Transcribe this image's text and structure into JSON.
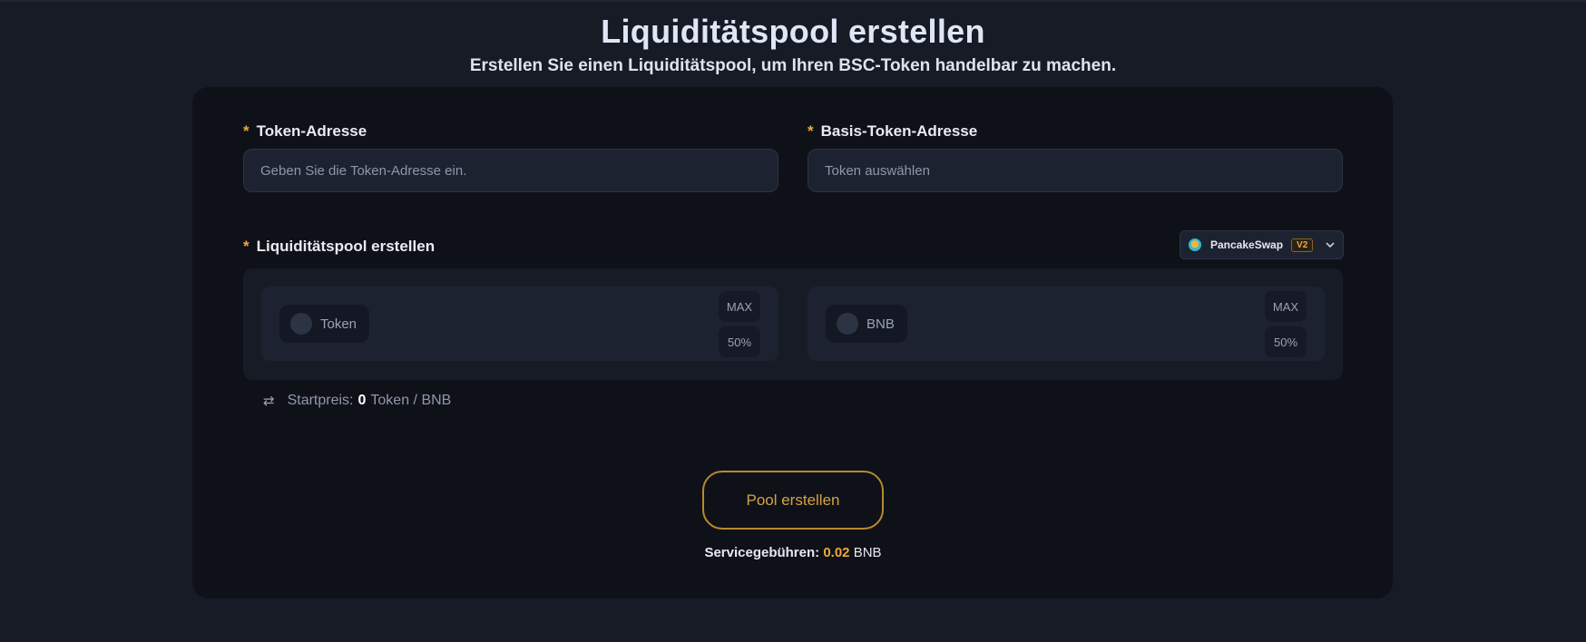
{
  "header": {
    "title": "Liquiditätspool erstellen",
    "subtitle": "Erstellen Sie einen Liquiditätspool, um Ihren BSC-Token handelbar zu machen."
  },
  "form": {
    "required_mark": "*",
    "token_address": {
      "label": "Token-Adresse",
      "placeholder": "Geben Sie die Token-Adresse ein."
    },
    "base_token_address": {
      "label": "Basis-Token-Adresse",
      "placeholder": "Token auswählen"
    },
    "pool_section": {
      "label": "Liquiditätspool erstellen",
      "dex": {
        "name": "PancakeSwap",
        "version": "V2",
        "icon": "pancakeswap-logo",
        "chevron": "chevron-down-icon"
      },
      "token_a": {
        "name": "Token",
        "max_label": "MAX",
        "half_label": "50%"
      },
      "token_b": {
        "name": "BNB",
        "max_label": "MAX",
        "half_label": "50%"
      }
    },
    "start_price": {
      "label": "Startpreis:",
      "value": "0",
      "unit": "Token / BNB",
      "icon": "swap-arrows-icon"
    }
  },
  "actions": {
    "create_pool_label": "Pool erstellen"
  },
  "fees": {
    "label": "Servicegebühren:",
    "value": "0.02",
    "unit": "BNB"
  },
  "colors": {
    "background": "#161b26",
    "card": "#0f1119",
    "accent": "#f0a73a",
    "button_border": "#b8892e"
  }
}
